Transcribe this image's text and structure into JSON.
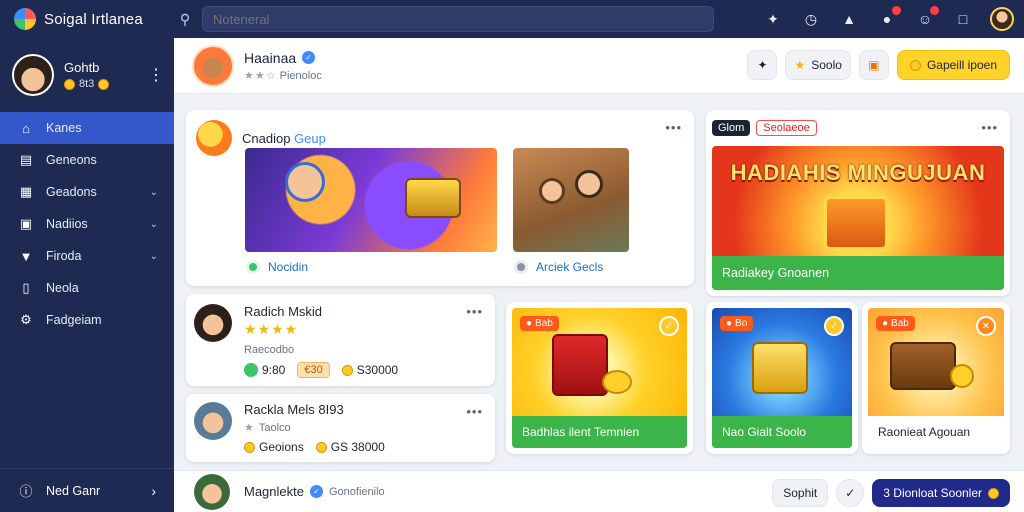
{
  "app": {
    "title": "Soigal Irtlanea"
  },
  "search": {
    "placeholder": "Noteneral"
  },
  "sidebar": {
    "profile": {
      "name": "Gohtb",
      "sub": "8t3"
    },
    "items": [
      {
        "label": "Kanes",
        "icon": "home-icon",
        "active": true,
        "chevron": false
      },
      {
        "label": "Geneons",
        "icon": "news-icon",
        "active": false,
        "chevron": false
      },
      {
        "label": "Geadons",
        "icon": "grid-icon",
        "active": false,
        "chevron": true
      },
      {
        "label": "Nadiios",
        "icon": "media-icon",
        "active": false,
        "chevron": true
      },
      {
        "label": "Firoda",
        "icon": "filter-icon",
        "active": false,
        "chevron": true
      },
      {
        "label": "Neola",
        "icon": "page-icon",
        "active": false,
        "chevron": false
      },
      {
        "label": "Fadgeiam",
        "icon": "settings-icon",
        "active": false,
        "chevron": false
      }
    ],
    "bottom": {
      "label": "Ned Ganr"
    }
  },
  "header": {
    "name": "Haainaa",
    "sub": "Pienoloc"
  },
  "header_actions": {
    "label1": "Soolo",
    "label2": "Gapeill ipoen"
  },
  "cards": {
    "featured": {
      "title_main": "Cnadiop",
      "title_accent": "Geup",
      "left_label": "Nocidin",
      "right_label": "Arciek Gecls"
    },
    "promo": {
      "tag1": "Glom",
      "tag2": "Seolaeoe",
      "title": "HADIAHIS MINGUJUAN",
      "bar": "Radiakey Gnoanen"
    },
    "player1": {
      "name": "Radich Mskid",
      "sub": "Raecodbo",
      "v1": "9:80",
      "v2": "€30",
      "v3": "S30000"
    },
    "player2": {
      "name": "Rackla Mels 8I93",
      "sub": "Taolco",
      "v1": "Geoions",
      "v2": "GS 38000"
    },
    "tile1": {
      "tag": "Bab",
      "label": "Badhlas ilent Temnien"
    },
    "tile2": {
      "tag": "Bo",
      "label": "Nao Gialt Soolo"
    },
    "tile3": {
      "tag": "Bab",
      "label": "Raonieat Agouan"
    }
  },
  "bottombar": {
    "name": "Magnlekte",
    "tag": "Gonofienilo",
    "btn1": "Sophit",
    "btn2": "3 Dionloat Soonler"
  },
  "colors": {
    "accent": "#3457c9",
    "nav_bg": "#1f2a52",
    "primary_btn": "#ffd32a",
    "success": "#3bb54a"
  }
}
